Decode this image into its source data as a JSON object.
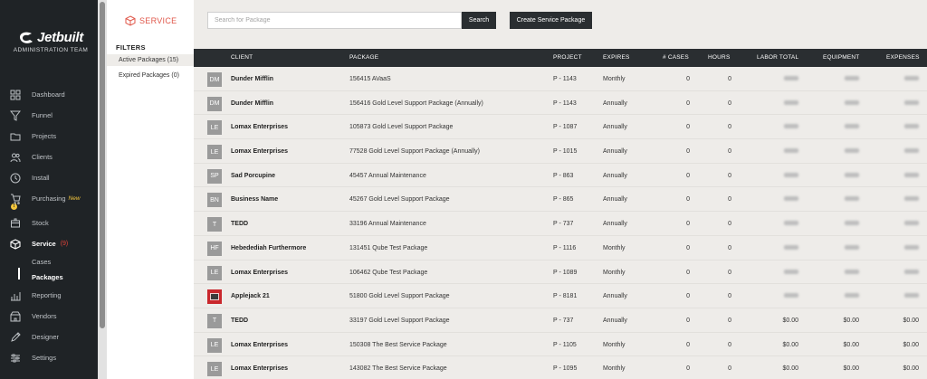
{
  "sidebar": {
    "logo": "Jetbuilt",
    "subtitle": "ADMINISTRATION TEAM",
    "items": [
      {
        "label": "Dashboard",
        "icon": "dashboard-icon"
      },
      {
        "label": "Funnel",
        "icon": "funnel-icon"
      },
      {
        "label": "Projects",
        "icon": "folder-icon"
      },
      {
        "label": "Clients",
        "icon": "users-icon"
      },
      {
        "label": "Install",
        "icon": "clock-icon"
      },
      {
        "label": "Purchasing",
        "icon": "cart-icon",
        "badge": "New",
        "alert": "!"
      },
      {
        "label": "Stock",
        "icon": "box-icon"
      },
      {
        "label": "Service",
        "icon": "cube-icon",
        "badge": "(9)"
      },
      {
        "label": "Reporting",
        "icon": "chart-icon"
      },
      {
        "label": "Vendors",
        "icon": "vendors-icon"
      },
      {
        "label": "Designer",
        "icon": "pencil-icon"
      },
      {
        "label": "Settings",
        "icon": "sliders-icon"
      }
    ],
    "subitems": [
      "Cases",
      "Packages"
    ]
  },
  "filter_panel": {
    "brand": "SERVICE",
    "title": "FILTERS",
    "filters": [
      "Active Packages (15)",
      "Expired Packages (0)"
    ]
  },
  "toolbar": {
    "search_placeholder": "Search for Package",
    "search_label": "Search",
    "create_label": "Create Service Package"
  },
  "table": {
    "headers": [
      "CLIENT",
      "PACKAGE",
      "PROJECT",
      "EXPIRES",
      "# CASES",
      "HOURS",
      "LABOR TOTAL",
      "EQUIPMENT",
      "EXPENSES"
    ],
    "rows": [
      {
        "avatar": "DM",
        "client": "Dunder Mifflin",
        "package": "156415 AVaaS",
        "project": "P - 1143",
        "expires": "Monthly",
        "cases": "0",
        "hours": "0",
        "labor": "",
        "equipment": "",
        "expenses": ""
      },
      {
        "avatar": "DM",
        "client": "Dunder Mifflin",
        "package": "156416 Gold Level Support Package (Annually)",
        "project": "P - 1143",
        "expires": "Annually",
        "cases": "0",
        "hours": "0",
        "labor": "",
        "equipment": "",
        "expenses": ""
      },
      {
        "avatar": "LE",
        "client": "Lomax Enterprises",
        "package": "105873 Gold Level Support Package",
        "project": "P - 1087",
        "expires": "Annually",
        "cases": "0",
        "hours": "0",
        "labor": "",
        "equipment": "",
        "expenses": ""
      },
      {
        "avatar": "LE",
        "client": "Lomax Enterprises",
        "package": "77528 Gold Level Support Package (Annually)",
        "project": "P - 1015",
        "expires": "Annually",
        "cases": "0",
        "hours": "0",
        "labor": "",
        "equipment": "",
        "expenses": ""
      },
      {
        "avatar": "SP",
        "client": "Sad Porcupine",
        "package": "45457 Annual Maintenance",
        "project": "P - 863",
        "expires": "Annually",
        "cases": "0",
        "hours": "0",
        "labor": "",
        "equipment": "",
        "expenses": ""
      },
      {
        "avatar": "BN",
        "client": "Business Name",
        "package": "45267 Gold Level Support Package",
        "project": "P - 865",
        "expires": "Annually",
        "cases": "0",
        "hours": "0",
        "labor": "",
        "equipment": "",
        "expenses": ""
      },
      {
        "avatar": "T",
        "client": "TEDD",
        "package": "33196 Annual Maintenance",
        "project": "P - 737",
        "expires": "Annually",
        "cases": "0",
        "hours": "0",
        "labor": "",
        "equipment": "",
        "expenses": ""
      },
      {
        "avatar": "HF",
        "client": "Hebedediah Furthermore",
        "package": "131451 Qube Test Package",
        "project": "P - 1116",
        "expires": "Monthly",
        "cases": "0",
        "hours": "0",
        "labor": "",
        "equipment": "",
        "expenses": ""
      },
      {
        "avatar": "LE",
        "client": "Lomax Enterprises",
        "package": "106462 Qube Test Package",
        "project": "P - 1089",
        "expires": "Monthly",
        "cases": "0",
        "hours": "0",
        "labor": "",
        "equipment": "",
        "expenses": ""
      },
      {
        "avatar": "",
        "client": "Applejack 21",
        "package": "51800 Gold Level Support Package",
        "project": "P - 8181",
        "expires": "Annually",
        "cases": "0",
        "hours": "0",
        "labor": "",
        "equipment": "",
        "expenses": ""
      },
      {
        "avatar": "T",
        "client": "TEDD",
        "package": "33197 Gold Level Support Package",
        "project": "P - 737",
        "expires": "Annually",
        "cases": "0",
        "hours": "0",
        "labor": "$0.00",
        "equipment": "$0.00",
        "expenses": "$0.00"
      },
      {
        "avatar": "LE",
        "client": "Lomax Enterprises",
        "package": "150308 The Best Service Package",
        "project": "P - 1105",
        "expires": "Monthly",
        "cases": "0",
        "hours": "0",
        "labor": "$0.00",
        "equipment": "$0.00",
        "expenses": "$0.00"
      },
      {
        "avatar": "LE",
        "client": "Lomax Enterprises",
        "package": "143082 The Best Service Package",
        "project": "P - 1095",
        "expires": "Monthly",
        "cases": "0",
        "hours": "0",
        "labor": "$0.00",
        "equipment": "$0.00",
        "expenses": "$0.00"
      }
    ]
  }
}
